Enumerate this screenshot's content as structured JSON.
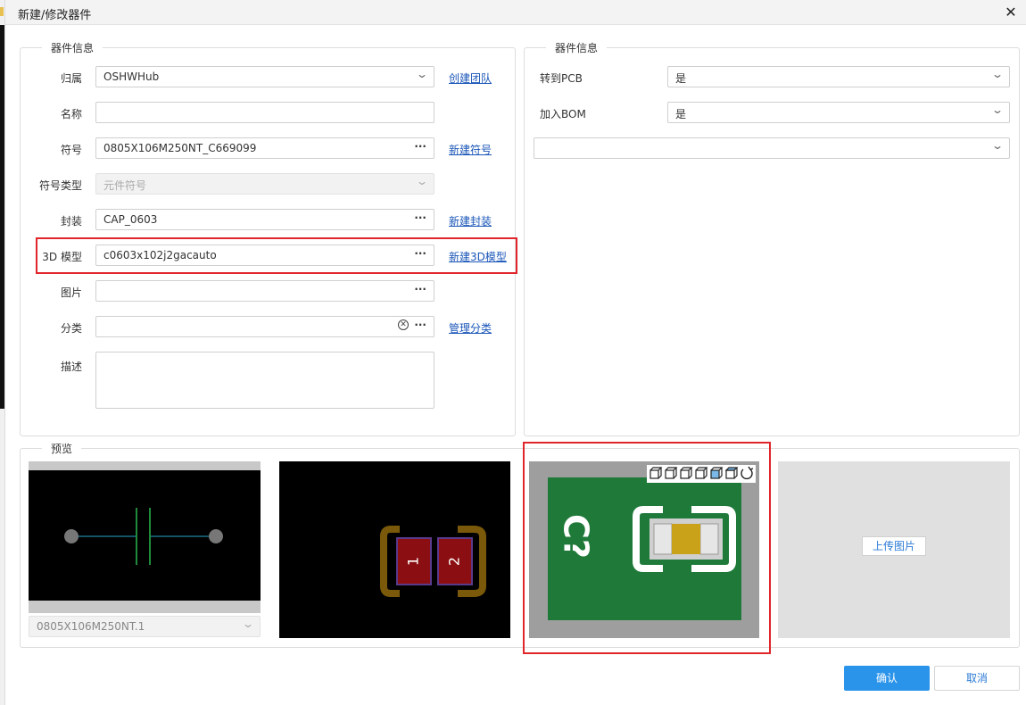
{
  "window": {
    "title": "新建/修改器件"
  },
  "left_group": {
    "legend": "器件信息",
    "belong": {
      "label": "归属",
      "value": "OSHWHub",
      "link": "创建团队"
    },
    "name": {
      "label": "名称",
      "value": ""
    },
    "symbol": {
      "label": "符号",
      "value": "0805X106M250NT_C669099",
      "link": "新建符号"
    },
    "symbol_type": {
      "label": "符号类型",
      "placeholder": "元件符号"
    },
    "footprint": {
      "label": "封装",
      "value": "CAP_0603",
      "link": "新建封装"
    },
    "model3d": {
      "label": "3D 模型",
      "value": "c0603x102j2gacauto",
      "link": "新建3D模型"
    },
    "image": {
      "label": "图片",
      "value": ""
    },
    "category": {
      "label": "分类",
      "value": "",
      "link": "管理分类"
    },
    "description": {
      "label": "描述",
      "value": ""
    }
  },
  "right_group": {
    "legend": "器件信息",
    "to_pcb": {
      "label": "转到PCB",
      "value": "是"
    },
    "add_bom": {
      "label": "加入BOM",
      "value": "是"
    },
    "extra_select": {
      "value": ""
    }
  },
  "preview": {
    "legend": "预览",
    "symbol_select": "0805X106M250NT.1",
    "footprint_pads": [
      "1",
      "2"
    ],
    "model_designator": "C?",
    "upload_label": "上传图片"
  },
  "buttons": {
    "confirm": "确认",
    "cancel": "取消"
  },
  "colors": {
    "accent": "#2a93ea",
    "link": "#1a56b8",
    "highlight": "#e0252b",
    "pcb_green": "#1f7a3a",
    "pad_red": "#8b0f12",
    "pad_outline": "#7a5a0a",
    "cap_body": "#c9a21a"
  },
  "icons": {
    "close": "close-icon",
    "dropdown": "chevron-down-icon",
    "more": "more-dots-icon",
    "clear": "clear-circle-icon"
  }
}
